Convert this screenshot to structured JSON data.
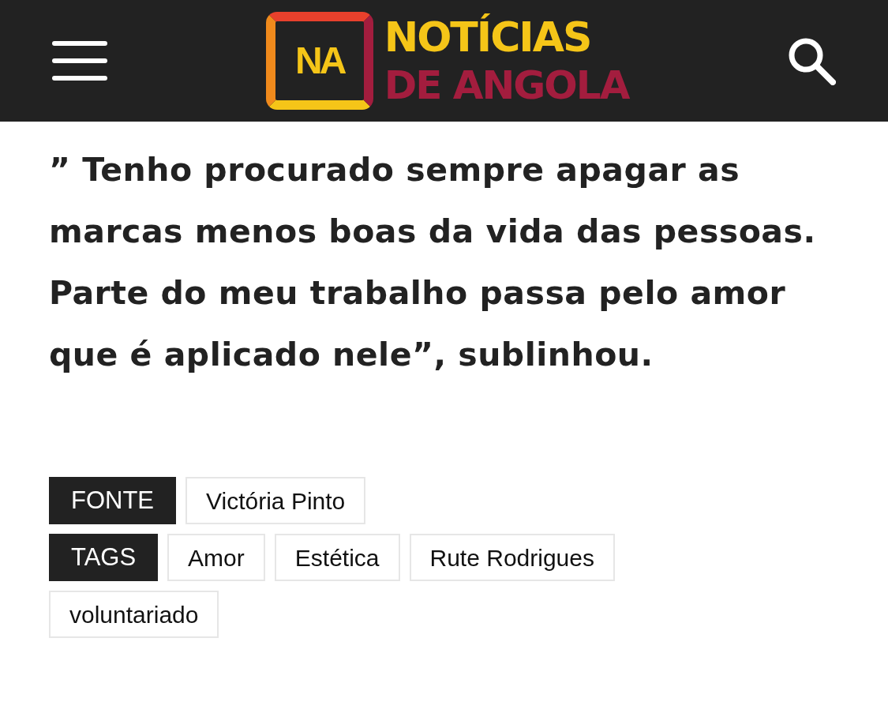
{
  "header": {
    "logo": {
      "mark": "NA",
      "line_1": "NOTÍCIAS",
      "line_2": "DE ANGOLA"
    }
  },
  "quote": "” Tenho procurado sempre apagar as marcas menos boas da vida das pessoas. Parte do meu trabalho passa pelo amor que é aplicado nele”, sublinhou.",
  "source": {
    "label": "FONTE",
    "items": [
      "Victória Pinto"
    ]
  },
  "tags": {
    "label": "TAGS",
    "items": [
      "Amor",
      "Estética",
      "Rute Rodrigues",
      "voluntariado"
    ]
  }
}
